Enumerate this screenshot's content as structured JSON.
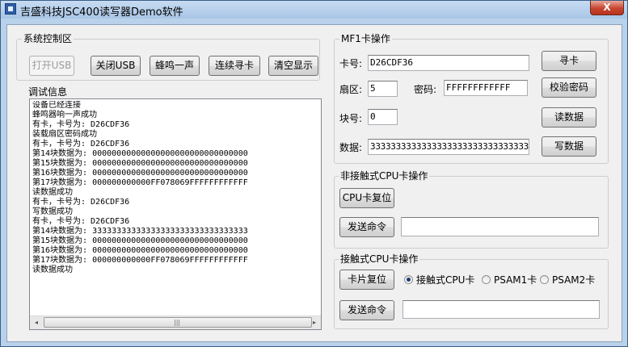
{
  "window": {
    "title": "吉盛科技JSC400读写器Demo软件",
    "close_label": "X"
  },
  "system": {
    "group_title": "系统控制区",
    "buttons": {
      "open": "打开USB",
      "close": "关闭USB",
      "beep": "蜂鸣一声",
      "continuous": "连续寻卡",
      "clear": "清空显示"
    }
  },
  "debug": {
    "group_title": "调试信息",
    "lines": [
      "设备已经连接",
      "蜂鸣器响一声成功",
      "有卡，卡号为: D26CDF36",
      "装载扇区密码成功",
      "有卡，卡号为: D26CDF36",
      "第14块数据为: 00000000000000000000000000000000",
      "第15块数据为: 00000000000000000000000000000000",
      "第16块数据为: 00000000000000000000000000000000",
      "第17块数据为: 000000000000FF078069FFFFFFFFFFFF",
      "读数据成功",
      "有卡，卡号为: D26CDF36",
      "写数据成功",
      "有卡，卡号为: D26CDF36",
      "第14块数据为: 33333333333333333333333333333333",
      "第15块数据为: 00000000000000000000000000000000",
      "第16块数据为: 00000000000000000000000000000000",
      "第17块数据为: 000000000000FF078069FFFFFFFFFFFF",
      "读数据成功"
    ],
    "scroll_left": "◂",
    "scroll_right": "▸",
    "scroll_grip": "|||"
  },
  "mf1": {
    "group_title": "MF1卡操作",
    "card_label": "卡号:",
    "card_value": "D26CDF36",
    "sector_label": "扇区:",
    "sector_value": "5",
    "password_label": "密码:",
    "password_value": "FFFFFFFFFFFF",
    "block_label": "块号:",
    "block_value": "0",
    "data_label": "数据:",
    "data_value": "33333333333333333333333333333333",
    "buttons": {
      "find": "寻卡",
      "verify": "校验密码",
      "read": "读数据",
      "write": "写数据"
    }
  },
  "contactless": {
    "group_title": "非接触式CPU卡操作",
    "reset_button": "CPU卡复位",
    "send_button": "发送命令",
    "command_value": ""
  },
  "contact": {
    "group_title": "接触式CPU卡操作",
    "reset_button": "卡片复位",
    "send_button": "发送命令",
    "command_value": "",
    "radios": [
      {
        "label": "接触式CPU卡",
        "selected": true
      },
      {
        "label": "PSAM1卡",
        "selected": false
      },
      {
        "label": "PSAM2卡",
        "selected": false
      }
    ]
  }
}
